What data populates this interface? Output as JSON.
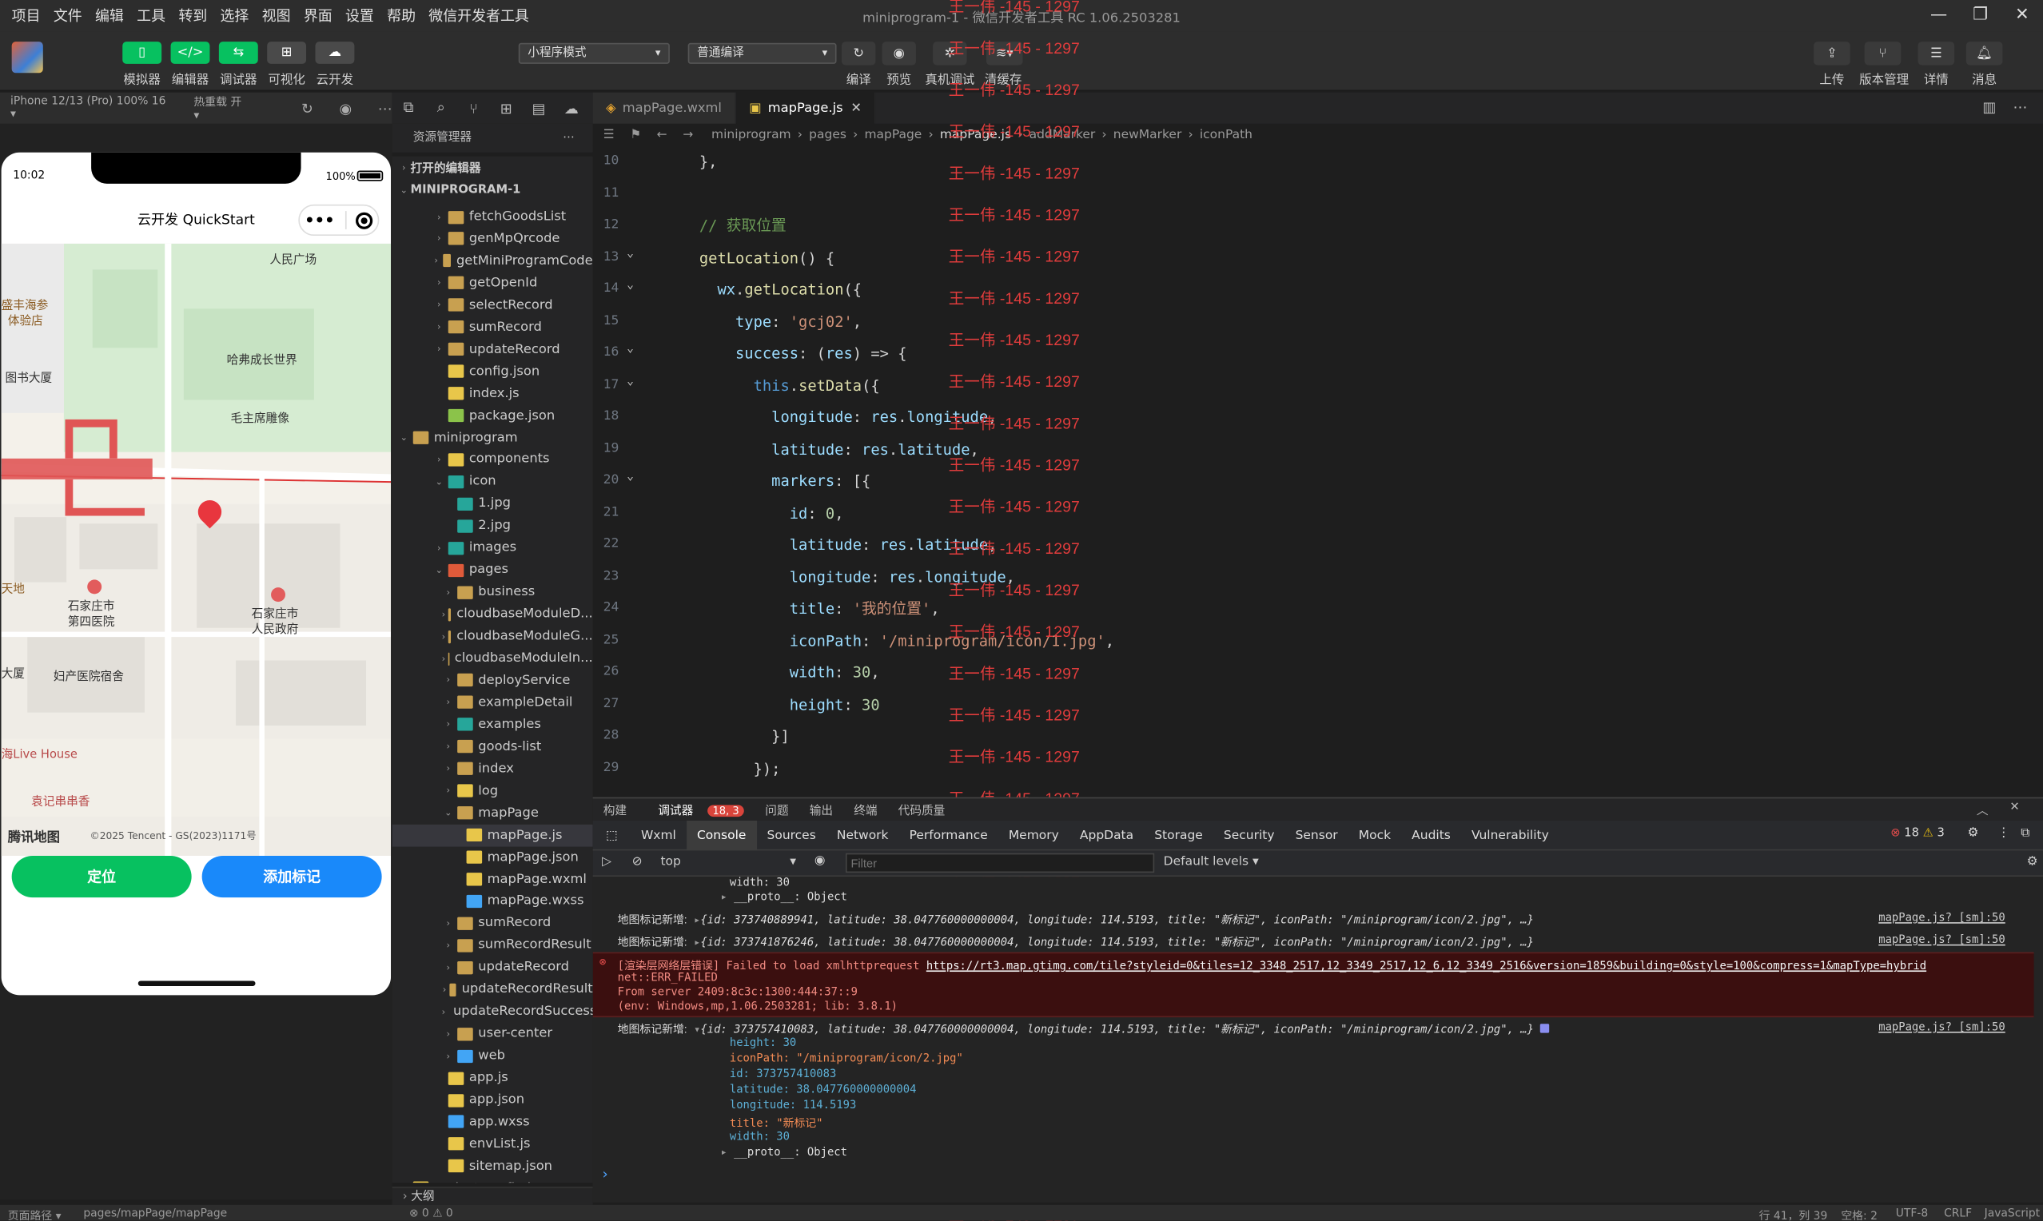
{
  "menu": [
    "项目",
    "文件",
    "编辑",
    "工具",
    "转到",
    "选择",
    "视图",
    "界面",
    "设置",
    "帮助",
    "微信开发者工具"
  ],
  "window_title": "miniprogram-1 - 微信开发者工具 RC 1.06.2503281",
  "window_controls": [
    "—",
    "❐",
    "✕"
  ],
  "toolbar": {
    "simulator": "模拟器",
    "editor": "编辑器",
    "debugger": "调试器",
    "visual": "可视化",
    "cloud": "云开发",
    "mode_select": "小程序模式",
    "compile_select": "普通编译",
    "compile": "编译",
    "preview": "预览",
    "remote_debug": "真机调试",
    "clear_cache": "清缓存",
    "upload": "上传",
    "version": "版本管理",
    "details": "详情",
    "messages": "消息"
  },
  "sim": {
    "device": "iPhone 12/13 (Pro) 100% 16 ▾",
    "hot_reload": "热重载 开 ▾"
  },
  "phone": {
    "time": "10:02",
    "battery": "100%",
    "title": "云开发 QuickStart",
    "capsule_more": "•••",
    "btn_locate": "定位",
    "btn_add": "添加标记",
    "map_labels": {
      "l1": "人民广场",
      "l2": "盛丰海参",
      "l2b": "体验店",
      "l3": "图书大厦",
      "l4": "哈弗成长世界",
      "l5": "毛主席雕像",
      "l6": "石家庄市",
      "l6b": "第四医院",
      "l7": "石家庄市",
      "l7b": "人民政府",
      "l8": "妇产医院宿舍",
      "l9": "天地",
      "l10": "大厦",
      "l11": "海Live House",
      "l12": "袁记串串香",
      "logo": "腾讯地图",
      "copyright": "©2025 Tencent - GS(2023)1171号"
    }
  },
  "explorer": {
    "title": "资源管理器",
    "open_editors": "打开的编辑器",
    "project": "MINIPROGRAM-1",
    "outline": "大纲",
    "items": [
      "fetchGoodsList",
      "genMpQrcode",
      "getMiniProgramCode",
      "getOpenId",
      "selectRecord",
      "sumRecord",
      "updateRecord",
      "config.json",
      "index.js",
      "package.json",
      "miniprogram",
      "components",
      "icon",
      "1.jpg",
      "2.jpg",
      "images",
      "pages",
      "business",
      "cloudbaseModuleD...",
      "cloudbaseModuleG...",
      "cloudbaseModuleIn...",
      "deployService",
      "exampleDetail",
      "examples",
      "goods-list",
      "index",
      "log",
      "mapPage",
      "mapPage.js",
      "mapPage.json",
      "mapPage.wxml",
      "mapPage.wxss",
      "sumRecord",
      "sumRecordResult",
      "updateRecord",
      "updateRecordResult",
      "updateRecordSuccess",
      "user-center",
      "web",
      "app.js",
      "app.json",
      "app.wxss",
      "envList.js",
      "sitemap.json",
      "project.config.json"
    ]
  },
  "editor": {
    "tabs": [
      "mapPage.wxml",
      "mapPage.js"
    ],
    "breadcrumb": [
      "miniprogram",
      "pages",
      "mapPage",
      "mapPage.js",
      "addMarker",
      "newMarker",
      "iconPath"
    ]
  },
  "code_lines": [
    {
      "n": "10",
      "t": "    },"
    },
    {
      "n": "11",
      "t": ""
    },
    {
      "n": "12",
      "t": "    // 获取位置"
    },
    {
      "n": "13",
      "t": "    getLocation() {"
    },
    {
      "n": "14",
      "t": "      wx.getLocation({"
    },
    {
      "n": "15",
      "t": "        type: 'gcj02',"
    },
    {
      "n": "16",
      "t": "        success: (res) => {"
    },
    {
      "n": "17",
      "t": "          this.setData({"
    },
    {
      "n": "18",
      "t": "            longitude: res.longitude,"
    },
    {
      "n": "19",
      "t": "            latitude: res.latitude,"
    },
    {
      "n": "20",
      "t": "            markers: [{"
    },
    {
      "n": "21",
      "t": "              id: 0,"
    },
    {
      "n": "22",
      "t": "              latitude: res.latitude,"
    },
    {
      "n": "23",
      "t": "              longitude: res.longitude,"
    },
    {
      "n": "24",
      "t": "              title: '我的位置',"
    },
    {
      "n": "25",
      "t": "              iconPath: '/miniprogram/icon/1.jpg',"
    },
    {
      "n": "26",
      "t": "              width: 30,"
    },
    {
      "n": "27",
      "t": "              height: 30"
    },
    {
      "n": "28",
      "t": "            }]"
    },
    {
      "n": "29",
      "t": "          });"
    }
  ],
  "watermark": "王一伟 -145 - 1297",
  "panel": {
    "tabs": [
      "构建",
      "调试器",
      "问题",
      "输出",
      "终端",
      "代码质量"
    ],
    "badge": "18, 3",
    "devtabs": [
      "Wxml",
      "Console",
      "Sources",
      "Network",
      "Performance",
      "Memory",
      "AppData",
      "Storage",
      "Security",
      "Sensor",
      "Mock",
      "Audits",
      "Vulnerability"
    ],
    "errors": "18",
    "warnings": "3",
    "context": "top",
    "filter_placeholder": "Filter",
    "levels": "Default levels ▾"
  },
  "console": {
    "r1": "width: 30",
    "r2": "__proto__: Object",
    "m1_label": "地图标记新增:",
    "m1": "{id: 373740889941, latitude: 38.047760000000004, longitude: 114.5193, title: \"新标记\", iconPath: \"/miniprogram/icon/2.jpg\", …}",
    "m2": "{id: 373741876246, latitude: 38.047760000000004, longitude: 114.5193, title: \"新标记\", iconPath: \"/miniprogram/icon/2.jpg\", …}",
    "src": "mapPage.js? [sm]:50",
    "err1": "[渲染层网络层错误] Failed to load xmlhttprequest",
    "err_url": "https://rt3.map.gtimg.com/tile?styleid=0&tiles=12_3348_2517,12_3349_2517,12_6,12_3349_2516&version=1859&building=0&style=100&compress=1&mapType=hybrid",
    "err2": "net::ERR_FAILED",
    "err3": "From server 2409:8c3c:1300:444:37::9",
    "err4": "(env: Windows,mp,1.06.2503281; lib: 3.8.1)",
    "m3": "{id: 373757410083, latitude: 38.047760000000004, longitude: 114.5193, title: \"新标记\", iconPath: \"/miniprogram/icon/2.jpg\", …}",
    "d1": "height: 30",
    "d2": "iconPath: \"/miniprogram/icon/2.jpg\"",
    "d3": "id: 373757410083",
    "d4": "latitude: 38.047760000000004",
    "d5": "longitude: 114.5193",
    "d6": "title: \"新标记\"",
    "d7": "width: 30",
    "d8": "__proto__: Object",
    "prompt": "›"
  },
  "status": {
    "path_label": "页面路径 ▾",
    "path": "pages/mapPage/mapPage",
    "problems": "⊗ 0 ⚠ 0",
    "cursor": "行 41，列 39",
    "spaces": "空格: 2",
    "encoding": "UTF-8",
    "eol": "CRLF",
    "lang": "JavaScript"
  },
  "colors": {
    "green": "#07c160",
    "blue": "#1989fa",
    "error_bg": "#3b0f0f",
    "watermark": "#e03c3c"
  }
}
